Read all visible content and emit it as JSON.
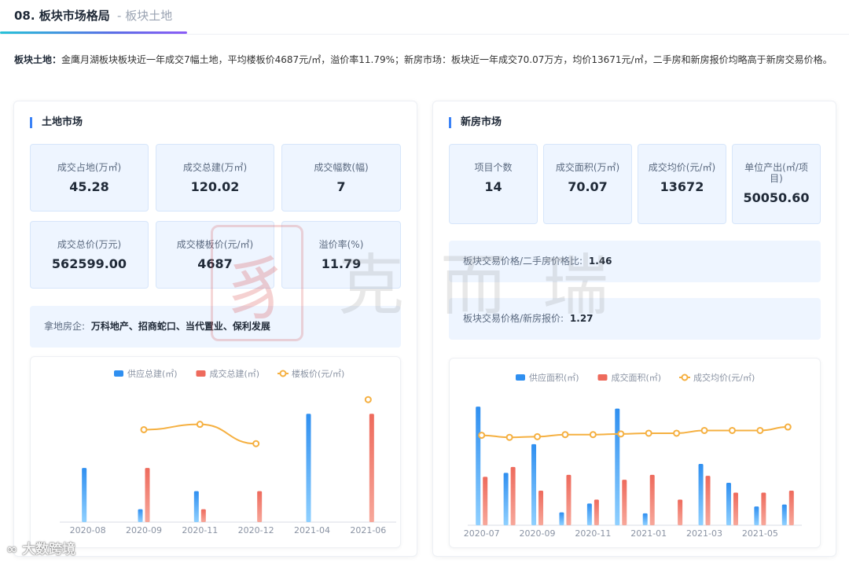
{
  "header": {
    "title": "08. 板块市场格局",
    "subtitle": "- 板块土地"
  },
  "summary": {
    "label": "板块土地：",
    "text": "金鹰月湖板块板块近一年成交7幅土地，平均楼板价4687元/㎡，溢价率11.79%；新房市场：板块近一年成交70.07万方，均价13671元/㎡，二手房和新房报价均略高于新房交易价格。"
  },
  "land": {
    "title": "土地市场",
    "stats": [
      {
        "label": "成交占地(万㎡)",
        "value": "45.28"
      },
      {
        "label": "成交总建(万㎡)",
        "value": "120.02"
      },
      {
        "label": "成交幅数(幅)",
        "value": "7"
      },
      {
        "label": "成交总价(万元)",
        "value": "562599.00"
      },
      {
        "label": "成交楼板价(元/㎡)",
        "value": "4687"
      },
      {
        "label": "溢价率(%)",
        "value": "11.79"
      }
    ],
    "buyers_label": "拿地房企:",
    "buyers": "万科地产、招商蛇口、当代置业、保利发展"
  },
  "newhouse": {
    "title": "新房市场",
    "stats": [
      {
        "label": "项目个数",
        "value": "14"
      },
      {
        "label": "成交面积(万㎡)",
        "value": "70.07"
      },
      {
        "label": "成交均价(元/㎡)",
        "value": "13672"
      },
      {
        "label": "单位产出(㎡/项目)",
        "value": "50050.60"
      }
    ],
    "ratio1_label": "板块交易价格/二手房价格比:",
    "ratio1_value": "1.46",
    "ratio2_label": "板块交易价格/新房报价:",
    "ratio2_value": "1.27"
  },
  "watermark": {
    "seal": "豸",
    "text": "克而瑞"
  },
  "footer": {
    "logo": "大数跨境"
  },
  "colors": {
    "blue": "#2f8ff0",
    "red": "#ee6a5c",
    "orange": "#f5b041",
    "accent": "#3b82f6"
  },
  "chart_data": [
    {
      "type": "bar",
      "categories": [
        "2020-08",
        "2020-09",
        "2020-11",
        "2020-12",
        "2021-04",
        "2021-06"
      ],
      "series": [
        {
          "name": "供应总建(㎡)",
          "kind": "bar",
          "axis": "left",
          "values": [
            420000,
            100000,
            240000,
            0,
            840000,
            0
          ]
        },
        {
          "name": "成交总建(㎡)",
          "kind": "bar",
          "axis": "left",
          "values": [
            0,
            420000,
            100000,
            240000,
            0,
            840000
          ]
        },
        {
          "name": "楼板价(元/㎡)",
          "kind": "line",
          "axis": "right",
          "values": [
            null,
            4300,
            4550,
            3650,
            null,
            5700
          ]
        }
      ],
      "ylim_left": [
        0,
        1000000
      ],
      "ylim_right": [
        0,
        6000
      ],
      "legend": "top"
    },
    {
      "type": "bar",
      "categories": [
        "2020-07",
        "2020-08",
        "2020-09",
        "2020-10",
        "2020-11",
        "2020-12",
        "2021-01",
        "2021-02",
        "2021-03",
        "2021-04",
        "2021-05",
        "2021-06"
      ],
      "x_tick_labels": [
        "2020-07",
        "2020-09",
        "2020-11",
        "2021-01",
        "2021-03",
        "2021-05"
      ],
      "series": [
        {
          "name": "供应面积(㎡)",
          "kind": "bar",
          "axis": "left",
          "values": [
            120000,
            53000,
            82000,
            13000,
            22000,
            118000,
            12000,
            0,
            62000,
            43000,
            19000,
            21000
          ]
        },
        {
          "name": "成交面积(㎡)",
          "kind": "bar",
          "axis": "left",
          "values": [
            49000,
            59000,
            35000,
            51000,
            26000,
            46000,
            51000,
            26000,
            50000,
            33000,
            33000,
            35000
          ]
        },
        {
          "name": "成交均价(元/㎡)",
          "kind": "line",
          "axis": "right",
          "values": [
            13000,
            12700,
            12800,
            13100,
            13100,
            13200,
            13300,
            13300,
            13700,
            13700,
            13700,
            14200
          ]
        }
      ],
      "ylim_left": [
        0,
        140000
      ],
      "ylim_right": [
        0,
        20000
      ],
      "legend": "top"
    }
  ]
}
